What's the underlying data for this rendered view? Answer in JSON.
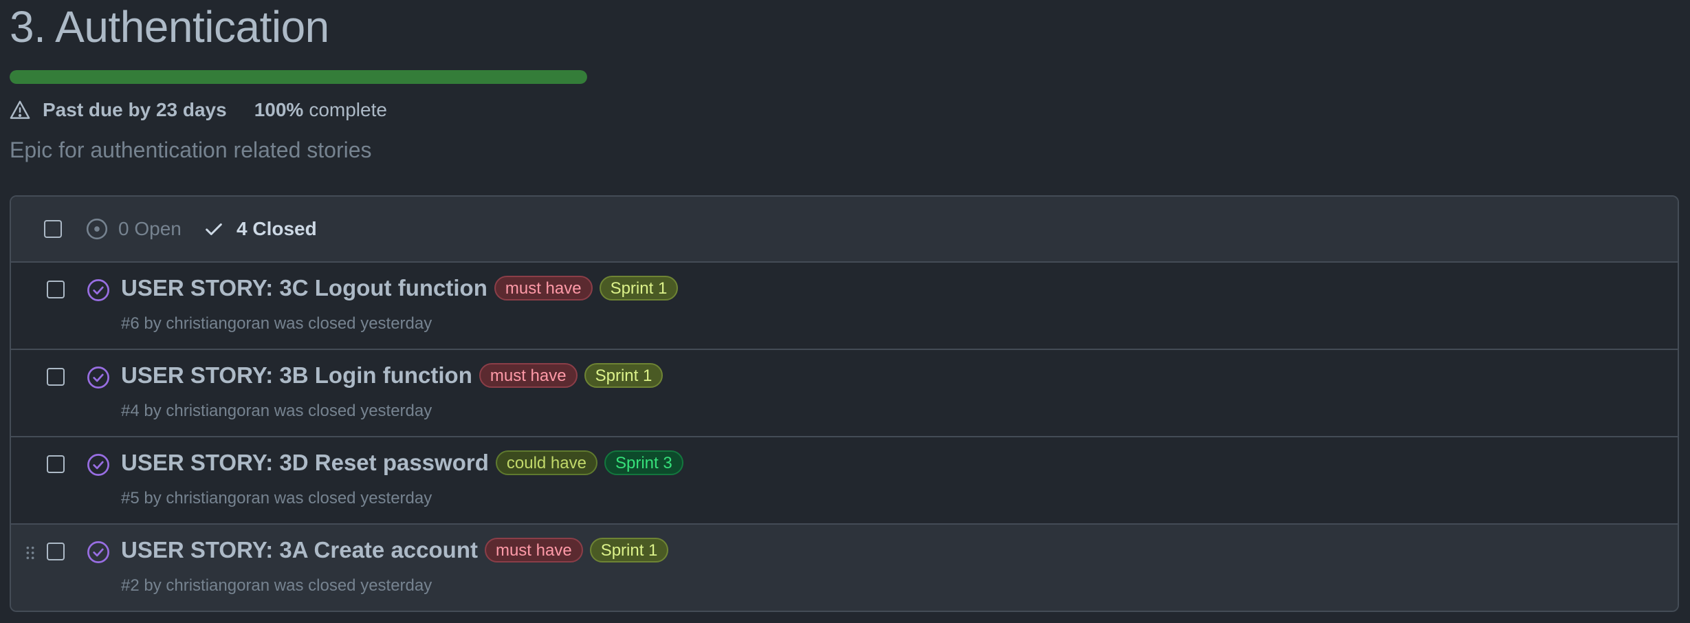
{
  "milestone": {
    "title": "3. Authentication",
    "progress_percent": 100,
    "due_status": "Past due by 23 days",
    "percent_label": "100%",
    "complete_label": "complete",
    "description": "Epic for authentication related stories"
  },
  "filter": {
    "open_label": "0 Open",
    "closed_label": "4 Closed"
  },
  "issues": [
    {
      "title": "USER STORY: 3C Logout function",
      "labels": [
        "must have",
        "Sprint 1"
      ],
      "meta": "#6 by christiangoran was closed yesterday"
    },
    {
      "title": "USER STORY: 3B Login function",
      "labels": [
        "must have",
        "Sprint 1"
      ],
      "meta": "#4 by christiangoran was closed yesterday"
    },
    {
      "title": "USER STORY: 3D Reset password",
      "labels": [
        "could have",
        "Sprint 3"
      ],
      "meta": "#5 by christiangoran was closed yesterday"
    },
    {
      "title": "USER STORY: 3A Create account",
      "labels": [
        "must have",
        "Sprint 1"
      ],
      "meta": "#2 by christiangoran was closed yesterday"
    }
  ],
  "colors": {
    "background": "#22272e",
    "progress": "#347d39",
    "closed_icon": "#986ee2"
  },
  "icons": {
    "due": "alert-icon",
    "open": "issue-opened-icon",
    "closed": "check-icon",
    "issue_status": "issue-closed-icon",
    "drag": "grabber-icon"
  }
}
